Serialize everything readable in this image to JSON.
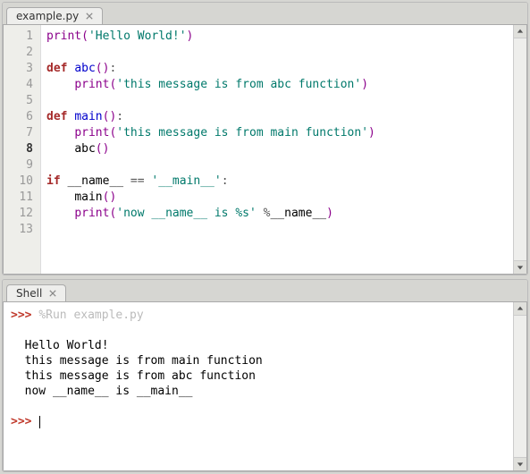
{
  "editor": {
    "tab_label": "example.py",
    "current_line": 8,
    "lines": [
      [
        {
          "t": "print",
          "c": "tk-builtin"
        },
        {
          "t": "(",
          "c": "tk-paren"
        },
        {
          "t": "'Hello World!'",
          "c": "tk-str"
        },
        {
          "t": ")",
          "c": "tk-paren"
        }
      ],
      [],
      [
        {
          "t": "def ",
          "c": "tk-kw"
        },
        {
          "t": "abc",
          "c": "tk-func"
        },
        {
          "t": "()",
          "c": "tk-paren"
        },
        {
          "t": ":",
          "c": "tk-op"
        }
      ],
      [
        {
          "t": "    ",
          "c": ""
        },
        {
          "t": "print",
          "c": "tk-builtin"
        },
        {
          "t": "(",
          "c": "tk-paren"
        },
        {
          "t": "'this message is from abc function'",
          "c": "tk-str"
        },
        {
          "t": ")",
          "c": "tk-paren"
        }
      ],
      [],
      [
        {
          "t": "def ",
          "c": "tk-kw"
        },
        {
          "t": "main",
          "c": "tk-func"
        },
        {
          "t": "()",
          "c": "tk-paren"
        },
        {
          "t": ":",
          "c": "tk-op"
        }
      ],
      [
        {
          "t": "    ",
          "c": ""
        },
        {
          "t": "print",
          "c": "tk-builtin"
        },
        {
          "t": "(",
          "c": "tk-paren"
        },
        {
          "t": "'this message is from main function'",
          "c": "tk-str"
        },
        {
          "t": ")",
          "c": "tk-paren"
        }
      ],
      [
        {
          "t": "    ",
          "c": ""
        },
        {
          "t": "abc",
          "c": "tk-var"
        },
        {
          "t": "()",
          "c": "tk-paren"
        }
      ],
      [],
      [
        {
          "t": "if ",
          "c": "tk-kw"
        },
        {
          "t": "__name__",
          "c": "tk-var"
        },
        {
          "t": " == ",
          "c": "tk-op"
        },
        {
          "t": "'__main__'",
          "c": "tk-str"
        },
        {
          "t": ":",
          "c": "tk-op"
        }
      ],
      [
        {
          "t": "    ",
          "c": ""
        },
        {
          "t": "main",
          "c": "tk-var"
        },
        {
          "t": "()",
          "c": "tk-paren"
        }
      ],
      [
        {
          "t": "    ",
          "c": ""
        },
        {
          "t": "print",
          "c": "tk-builtin"
        },
        {
          "t": "(",
          "c": "tk-paren"
        },
        {
          "t": "'now __name__ is %s'",
          "c": "tk-str"
        },
        {
          "t": " %",
          "c": "tk-op"
        },
        {
          "t": "__name__",
          "c": "tk-var"
        },
        {
          "t": ")",
          "c": "tk-paren"
        }
      ],
      []
    ]
  },
  "shell": {
    "tab_label": "Shell",
    "prompt": ">>>",
    "run_command": "%Run example.py",
    "output": [
      "Hello World!",
      "this message is from main function",
      "this message is from abc function",
      "now __name__ is __main__"
    ]
  }
}
